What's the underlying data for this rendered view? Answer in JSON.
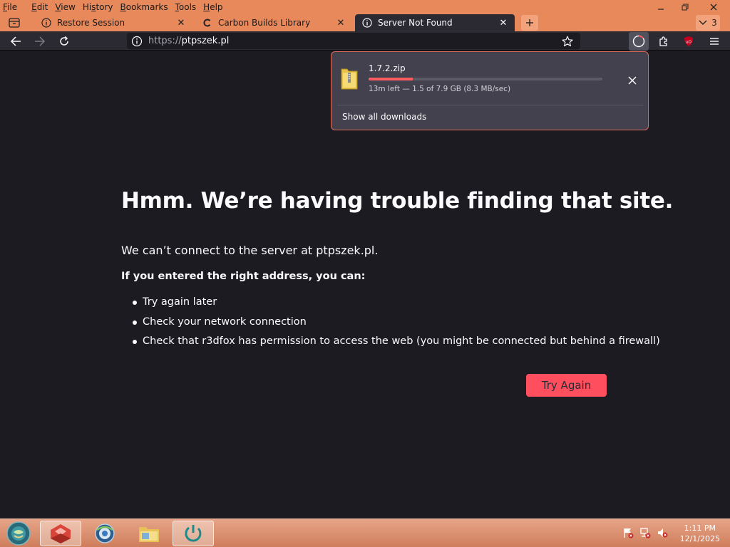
{
  "menubar": {
    "items": [
      "File",
      "Edit",
      "View",
      "History",
      "Bookmarks",
      "Tools",
      "Help"
    ],
    "access_keys": [
      "F",
      "E",
      "V",
      "s",
      "B",
      "T",
      "H"
    ]
  },
  "tabs": [
    {
      "title": "Restore Session",
      "icon": "info-icon"
    },
    {
      "title": "Carbon Builds Library",
      "icon": "site-c-icon"
    },
    {
      "title": "Server Not Found",
      "icon": "info-icon",
      "active": true
    }
  ],
  "tab_count": "3",
  "navbar": {
    "url_scheme": "https://",
    "url_host": "ptpszek.pl"
  },
  "download": {
    "filename": "1.7.2.zip",
    "progress_fraction": 0.19,
    "status": "13m left — 1.5 of 7.9 GB (8.3 MB/sec)",
    "show_all": "Show all downloads"
  },
  "error_page": {
    "title": "Hmm. We’re having trouble finding that site.",
    "message": "We can’t connect to the server at ptpszek.pl.",
    "subheading": "If you entered the right address, you can:",
    "suggestions": [
      "Try again later",
      "Check your network connection",
      "Check that r3dfox has permission to access the web (you might be connected but behind a firewall)"
    ],
    "try_again": "Try Again"
  },
  "taskbar": {
    "time": "1:11 PM",
    "date": "12/1/2025"
  },
  "colors": {
    "titlebar": "#e8895c",
    "page_bg": "#1c1b22",
    "accent_button": "#ff4f5e",
    "progress": "#ff5a5f"
  }
}
